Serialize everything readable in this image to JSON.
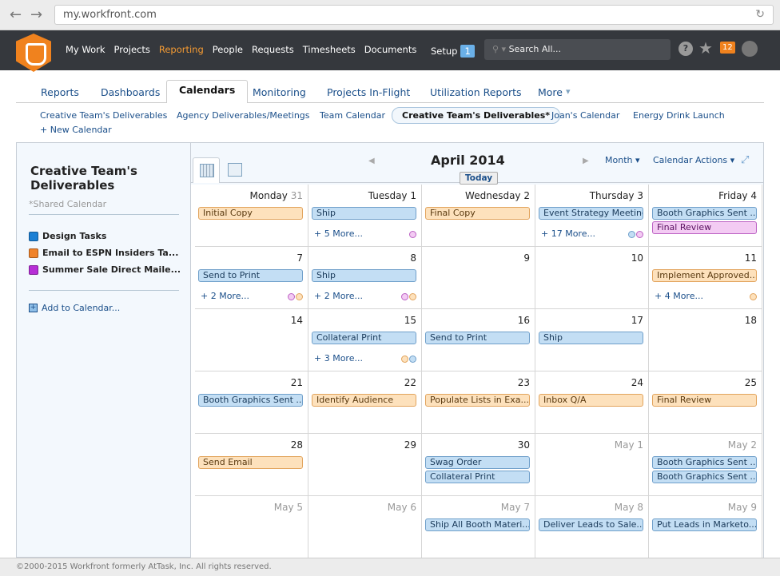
{
  "browser": {
    "url": "my.workfront.com"
  },
  "topnav": {
    "items": [
      "My Work",
      "Projects",
      "Reporting",
      "People",
      "Requests",
      "Timesheets",
      "Documents"
    ],
    "active": "Reporting",
    "setup": "Setup",
    "setup_badge": "1",
    "search_placeholder": "Search All...",
    "notifications": "12"
  },
  "tabs": [
    "Reports",
    "Dashboards",
    "Calendars",
    "Monitoring",
    "Projects In-Flight",
    "Utilization Reports",
    "More"
  ],
  "subnav": [
    "Creative Team's Deliverables",
    "Agency Deliverables/Meetings",
    "Team Calendar",
    "Creative Team's Deliverables*",
    "Joan's Calendar",
    "Energy Drink Launch",
    "+ New Calendar"
  ],
  "sidebar": {
    "title": "Creative Team's Deliverables",
    "subtitle": "*Shared Calendar",
    "calendars": [
      {
        "label": "Design Tasks",
        "color": "#1a7fd4"
      },
      {
        "label": "Email to ESPN Insiders Ta...",
        "color": "#f0822a"
      },
      {
        "label": "Summer Sale Direct Maile...",
        "color": "#b62ed6"
      }
    ],
    "add": "Add to Calendar..."
  },
  "calendar": {
    "month": "April 2014",
    "today": "Today",
    "view": "Month",
    "actions": "Calendar Actions",
    "colors": {
      "blue": "#c3def4",
      "orange": "#fde1bc",
      "purple": "#f3cbf3"
    },
    "weeks": [
      [
        {
          "label": "Monday",
          "num": "31",
          "muted_num": true,
          "events": [
            [
              "Initial Copy",
              "orange"
            ]
          ]
        },
        {
          "label": "Tuesday",
          "num": "1",
          "events": [
            [
              "Ship",
              "blue"
            ]
          ],
          "more": "+ 5 More...",
          "dots": [
            "purple"
          ]
        },
        {
          "label": "Wednesday",
          "num": "2",
          "events": [
            [
              "Final Copy",
              "orange"
            ]
          ]
        },
        {
          "label": "Thursday",
          "num": "3",
          "events": [
            [
              "Event Strategy Meeting",
              "blue"
            ]
          ],
          "more": "+ 17 More...",
          "dots": [
            "blue",
            "purple"
          ]
        },
        {
          "label": "Friday",
          "num": "4",
          "events": [
            [
              "Booth Graphics Sent ...",
              "blue"
            ],
            [
              "Final Review",
              "purple"
            ]
          ]
        }
      ],
      [
        {
          "num": "7",
          "events": [
            [
              "Send to Print",
              "blue"
            ]
          ],
          "more": "+ 2 More...",
          "dots": [
            "purple",
            "orange"
          ]
        },
        {
          "num": "8",
          "events": [
            [
              "Ship",
              "blue"
            ]
          ],
          "more": "+ 2 More...",
          "dots": [
            "purple",
            "orange"
          ]
        },
        {
          "num": "9",
          "events": []
        },
        {
          "num": "10",
          "events": []
        },
        {
          "num": "11",
          "events": [
            [
              "Implement Approved...",
              "orange"
            ]
          ],
          "more": "+ 4 More...",
          "dots": [
            "orange"
          ]
        }
      ],
      [
        {
          "num": "14",
          "events": []
        },
        {
          "num": "15",
          "events": [
            [
              "Collateral Print",
              "blue"
            ]
          ],
          "more": "+ 3 More...",
          "dots": [
            "orange",
            "blue"
          ]
        },
        {
          "num": "16",
          "events": [
            [
              "Send to Print",
              "blue"
            ]
          ]
        },
        {
          "num": "17",
          "events": [
            [
              "Ship",
              "blue"
            ]
          ]
        },
        {
          "num": "18",
          "events": []
        }
      ],
      [
        {
          "num": "21",
          "events": [
            [
              "Booth Graphics Sent ...",
              "blue"
            ]
          ]
        },
        {
          "num": "22",
          "events": [
            [
              "Identify Audience",
              "orange"
            ]
          ]
        },
        {
          "num": "23",
          "events": [
            [
              "Populate Lists in Exa...",
              "orange"
            ]
          ]
        },
        {
          "num": "24",
          "events": [
            [
              "Inbox Q/A",
              "orange"
            ]
          ]
        },
        {
          "num": "25",
          "events": [
            [
              "Final Review",
              "orange"
            ]
          ]
        }
      ],
      [
        {
          "num": "28",
          "events": [
            [
              "Send Email",
              "orange"
            ]
          ]
        },
        {
          "num": "29",
          "events": []
        },
        {
          "num": "30",
          "events": [
            [
              "Swag Order",
              "blue"
            ],
            [
              "Collateral Print",
              "blue"
            ]
          ]
        },
        {
          "num": "May  1",
          "muted": true,
          "events": []
        },
        {
          "num": "May  2",
          "muted": true,
          "events": [
            [
              "Booth Graphics Sent ...",
              "blue"
            ],
            [
              "Booth Graphics Sent ...",
              "blue"
            ]
          ]
        }
      ],
      [
        {
          "num": "May  5",
          "muted": true,
          "events": []
        },
        {
          "num": "May  6",
          "muted": true,
          "events": []
        },
        {
          "num": "May  7",
          "muted": true,
          "events": [
            [
              "Ship All Booth Materi...",
              "blue"
            ]
          ]
        },
        {
          "num": "May  8",
          "muted": true,
          "events": [
            [
              "Deliver Leads to Sale...",
              "blue"
            ]
          ]
        },
        {
          "num": "May  9",
          "muted": true,
          "events": [
            [
              "Put Leads in Marketo...",
              "blue"
            ]
          ]
        }
      ]
    ]
  },
  "footer": "©2000-2015 Workfront formerly AtTask, Inc. All rights reserved."
}
